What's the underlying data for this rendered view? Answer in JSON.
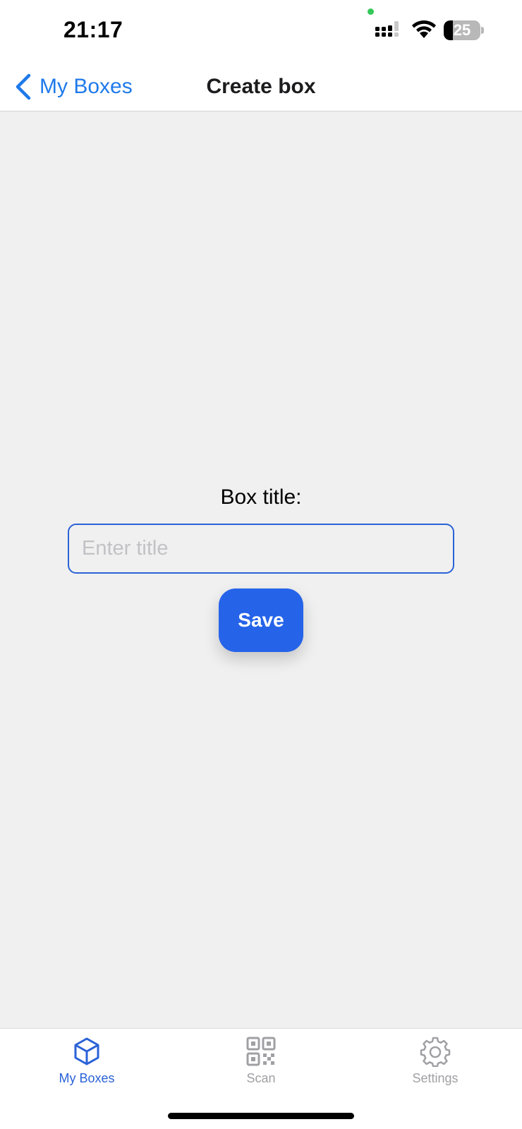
{
  "status_bar": {
    "time": "21:17",
    "battery_level": "25",
    "battery_fraction": 0.25,
    "icons": [
      "signal-icon",
      "wifi-icon",
      "battery-icon"
    ]
  },
  "nav": {
    "back_label": "My Boxes",
    "title": "Create box"
  },
  "form": {
    "label": "Box title:",
    "input_value": "",
    "input_placeholder": "Enter title",
    "save_label": "Save"
  },
  "tabs": [
    {
      "label": "My Boxes",
      "icon": "cube-icon",
      "active": true
    },
    {
      "label": "Scan",
      "icon": "qr-code-icon",
      "active": false
    },
    {
      "label": "Settings",
      "icon": "gear-icon",
      "active": false
    }
  ],
  "colors": {
    "accent": "#1f7aea",
    "button": "#2563e9",
    "background": "#f0f0f0",
    "tab_inactive": "#a0a0a4"
  }
}
